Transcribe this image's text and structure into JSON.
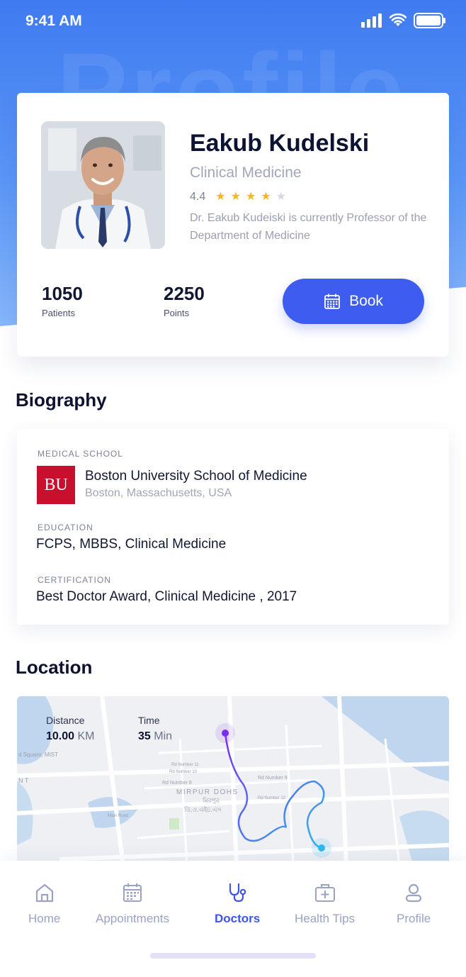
{
  "status_bar": {
    "time": "9:41 AM"
  },
  "header": {
    "watermark": "Profile"
  },
  "doctor": {
    "name": "Eakub Kudelski",
    "specialty": "Clinical Medicine",
    "rating": "4.4",
    "rating_stars": 4,
    "description": "Dr. Eakub Kudeiski is currently Professor of the Department of Medicine",
    "patients_value": "1050",
    "patients_label": "Patients",
    "points_value": "2250",
    "points_label": "Points",
    "book_label": "Book"
  },
  "biography": {
    "title": "Biography",
    "medical_school_label": "MEDICAL SCHOOL",
    "logo_text": "BU",
    "school_name": "Boston University School of Medicine",
    "school_location": "Boston, Massachusetts, USA",
    "education_label": "EDUCATION",
    "education_value": "FCPS, MBBS, Clinical Medicine",
    "certification_label": "CERTIFICATION",
    "certification_value": "Best Doctor Award, Clinical Medicine , 2017"
  },
  "location": {
    "title": "Location",
    "distance_label": "Distance",
    "distance_value": "10.00",
    "distance_unit": "KM",
    "time_label": "Time",
    "time_value": "35",
    "time_unit": "Min",
    "map_labels": {
      "area": "MIRPUR DOHS",
      "area_bn": "মিরপুর",
      "area_bn2": "ডি.ও.এইচ.এস",
      "square": "d Square, MIST",
      "nt": "N T",
      "rd9a": "Rd Number 9",
      "rd9b": "Rd Number 9",
      "rd10": "Rd Number 10",
      "rd11": "Rd Number 11",
      "rd12": "Rd Number 12",
      "main": "Main Road"
    }
  },
  "bottom_nav": {
    "items": [
      {
        "label": "Home",
        "icon": "home-icon"
      },
      {
        "label": "Appointments",
        "icon": "calendar-icon"
      },
      {
        "label": "Doctors",
        "icon": "stethoscope-icon"
      },
      {
        "label": "Health Tips",
        "icon": "first-aid-kit-icon"
      },
      {
        "label": "Profile",
        "icon": "user-icon"
      }
    ],
    "active": "Doctors"
  },
  "colors": {
    "primary": "#3e5df0",
    "header_gradient_top": "#3f7bf0",
    "star": "#f5b81a",
    "route_start": "#7b2ff0",
    "route_end": "#2fb6f0"
  }
}
